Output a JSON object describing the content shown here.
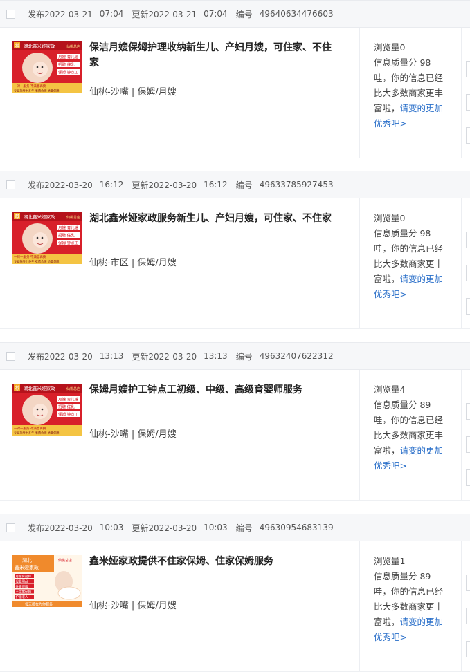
{
  "items": [
    {
      "published": "发布2022-03-21",
      "published_time": "07:04",
      "updated": "更新2022-03-21",
      "updated_time": "07:04",
      "id_label": "编号",
      "id": "49640634476603",
      "title": "保洁月嫂保姆护理收纳新生儿、产妇月嫂，可住家、不住家",
      "location": "仙桃-沙嘴 | 保姆/月嫂",
      "views": "浏览量0",
      "quality": "信息质量分 98",
      "msg": "哇，你的信息已经比大多数商家更丰富啦，",
      "link": "请变的更加优秀吧>",
      "thumb": "a"
    },
    {
      "published": "发布2022-03-20",
      "published_time": "16:12",
      "updated": "更新2022-03-20",
      "updated_time": "16:12",
      "id_label": "编号",
      "id": "49633785927453",
      "title": "湖北鑫米娅家政服务新生儿、产妇月嫂，可住家、不住家",
      "location": "仙桃-市区 | 保姆/月嫂",
      "views": "浏览量0",
      "quality": "信息质量分 98",
      "msg": "哇，你的信息已经比大多数商家更丰富啦，",
      "link": "请变的更加优秀吧>",
      "thumb": "a"
    },
    {
      "published": "发布2022-03-20",
      "published_time": "13:13",
      "updated": "更新2022-03-20",
      "updated_time": "13:13",
      "id_label": "编号",
      "id": "49632407622312",
      "title": "保姆月嫂护工钟点工初级、中级、高级育婴师服务",
      "location": "仙桃-沙嘴 | 保姆/月嫂",
      "views": "浏览量4",
      "quality": "信息质量分 89",
      "msg": "哇，你的信息已经比大多数商家更丰富啦，",
      "link": "请变的更加优秀吧>",
      "thumb": "a"
    },
    {
      "published": "发布2022-03-20",
      "published_time": "10:03",
      "updated": "更新2022-03-20",
      "updated_time": "10:03",
      "id_label": "编号",
      "id": "49630954683139",
      "title": "鑫米娅家政提供不住家保姆、住家保姆服务",
      "location": "仙桃-沙嘴 | 保姆/月嫂",
      "views": "浏览量1",
      "quality": "信息质量分 89",
      "msg": "哇，你的信息已经比大多数商家更丰富啦，",
      "link": "请变的更加优秀吧>",
      "thumb": "b"
    }
  ],
  "thumb_a": {
    "badge": "荐",
    "brand": "湖北鑫米娅家政",
    "tag": "仙桃总店",
    "services": [
      "月嫂 育儿嫂",
      "招聘 催乳",
      "保姆 钟点工"
    ],
    "slogan": "一对一服务 不满意再换",
    "footer": "专业指导十多年 收费合理 质量保障"
  },
  "thumb_b": {
    "region": "湖北",
    "brand": "鑫米娅家政",
    "tag": "仙桃总店",
    "services": [
      "月嫂育婴师",
      "母婴用品",
      "住家保姆",
      "不住家保姆",
      "护理老人"
    ],
    "footer": "每天都在为你服务"
  },
  "colors": {
    "link": "#2a6fc9",
    "thumb_red": "#d8202a",
    "thumb_orange": "#f08a2c"
  }
}
